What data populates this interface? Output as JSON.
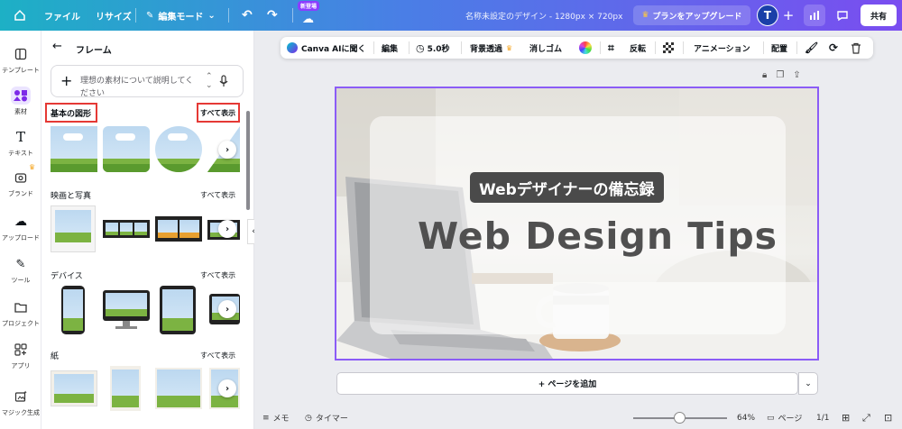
{
  "topbar": {
    "menu_file": "ファイル",
    "menu_resize": "リサイズ",
    "edit_mode": "編集モード",
    "new_badge": "新登場",
    "doc_name": "名称未設定のデザイン - 1280px × 720px",
    "upgrade": "プランをアップグレード",
    "avatar_initial": "T",
    "share": "共有"
  },
  "rail": {
    "items": [
      {
        "label": "テンプレート",
        "icon": "template-icon"
      },
      {
        "label": "素材",
        "icon": "elements-icon"
      },
      {
        "label": "テキスト",
        "icon": "text-icon"
      },
      {
        "label": "ブランド",
        "icon": "brand-icon"
      },
      {
        "label": "アップロード",
        "icon": "upload-icon"
      },
      {
        "label": "ツール",
        "icon": "tools-icon"
      },
      {
        "label": "プロジェクト",
        "icon": "folder-icon"
      },
      {
        "label": "アプリ",
        "icon": "apps-icon"
      },
      {
        "label": "マジック生成",
        "icon": "magic-icon"
      }
    ]
  },
  "panel": {
    "title": "フレーム",
    "search_placeholder": "理想の素材について説明してください",
    "sections": [
      {
        "title": "基本の図形",
        "see_all": "すべて表示"
      },
      {
        "title": "映画と写真",
        "see_all": "すべて表示"
      },
      {
        "title": "デバイス",
        "see_all": "すべて表示"
      },
      {
        "title": "紙",
        "see_all": "すべて表示"
      }
    ]
  },
  "context_toolbar": {
    "canva_ai": "Canva AIに聞く",
    "edit": "編集",
    "duration": "5.0秒",
    "bg_remove": "背景透過",
    "eraser": "消しゴム",
    "flip": "反転",
    "animation": "アニメーション",
    "position": "配置"
  },
  "design": {
    "subtitle": "Webデザイナーの備忘録",
    "title": "Web Design Tips"
  },
  "canvas": {
    "add_page": "+ ページを追加"
  },
  "bottombar": {
    "notes": "メモ",
    "timer": "タイマー",
    "zoom": "64%",
    "pages": "ページ",
    "page_count": "1/1"
  },
  "colors": {
    "accent": "#8b5cf6",
    "highlight": "#e53935"
  }
}
